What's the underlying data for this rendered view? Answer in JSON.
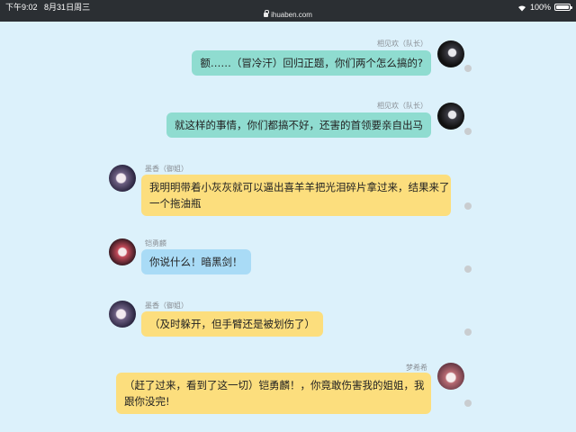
{
  "status_bar": {
    "time": "下午9:02",
    "date": "8月31日周三",
    "url": "ihuaben.com",
    "battery": "100%"
  },
  "messages": [
    {
      "speaker": "相见欢（队长）",
      "text": "额……（冒冷汗）回归正题，你们两个怎么搞的?",
      "side": "right",
      "color": "teal",
      "avatar": "dark-haired-avatar"
    },
    {
      "speaker": "相见欢（队长）",
      "text": "就这样的事情，你们都搞不好，还害的首领要亲自出马",
      "side": "right",
      "color": "teal",
      "avatar": "dark-haired-avatar"
    },
    {
      "speaker": "墨香（御姐）",
      "text_line1": "我明明带着小灰灰就可以逼出喜羊羊把光泪碎片拿过来，结果来了",
      "text_line2": "一个拖油瓶",
      "side": "left",
      "color": "yellow",
      "avatar": "purple-avatar"
    },
    {
      "speaker": "铠勇麟",
      "text": "你说什么！暗黑剑！",
      "side": "left",
      "color": "blue",
      "avatar": "red-avatar"
    },
    {
      "speaker": "墨香（御姐）",
      "text": "（及时躲开，但手臂还是被划伤了）",
      "side": "left",
      "color": "yellow",
      "avatar": "purple-avatar"
    },
    {
      "speaker": "梦希希",
      "text_line1": "（赶了过来，看到了这一切）铠勇麟！，你竟敢伤害我的姐姐，我",
      "text_line2": "跟你没完!",
      "side": "right",
      "color": "yellow",
      "avatar": "pink-avatar"
    }
  ]
}
